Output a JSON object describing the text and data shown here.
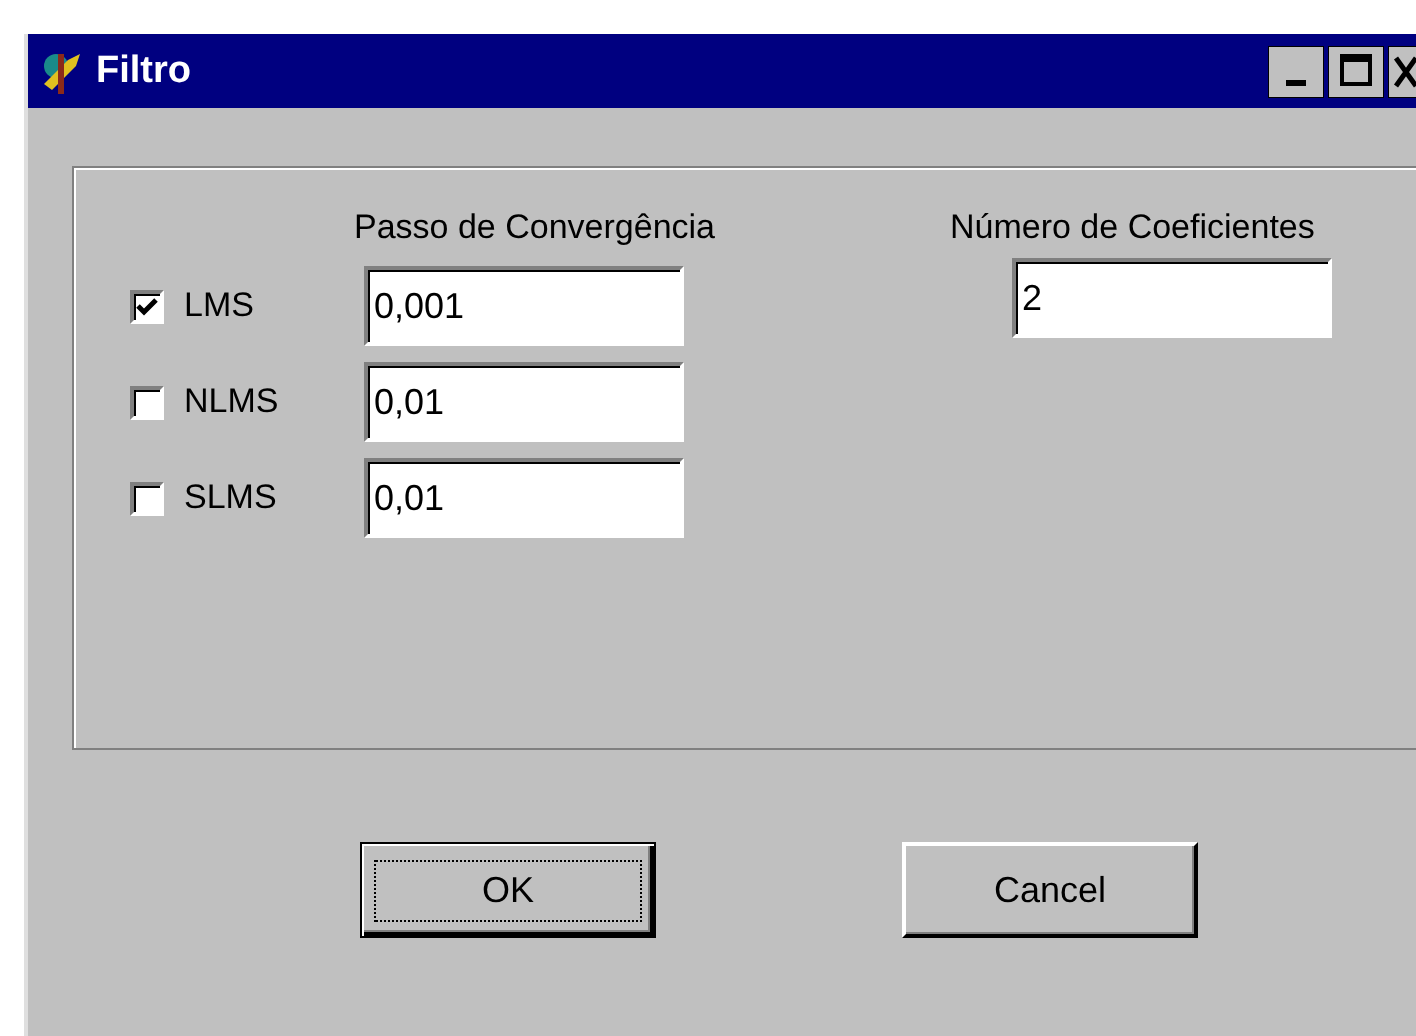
{
  "window": {
    "title": "Filtro"
  },
  "step_heading": "Passo de Convergência",
  "algorithms": [
    {
      "label": "LMS",
      "checked": true,
      "step": "0,001"
    },
    {
      "label": "NLMS",
      "checked": false,
      "step": "0,01"
    },
    {
      "label": "SLMS",
      "checked": false,
      "step": "0,01"
    }
  ],
  "coefficients": {
    "heading": "Número de Coeficientes",
    "value": "2"
  },
  "buttons": [
    {
      "label": "OK",
      "default": true
    },
    {
      "label": "Cancel",
      "default": false
    }
  ]
}
